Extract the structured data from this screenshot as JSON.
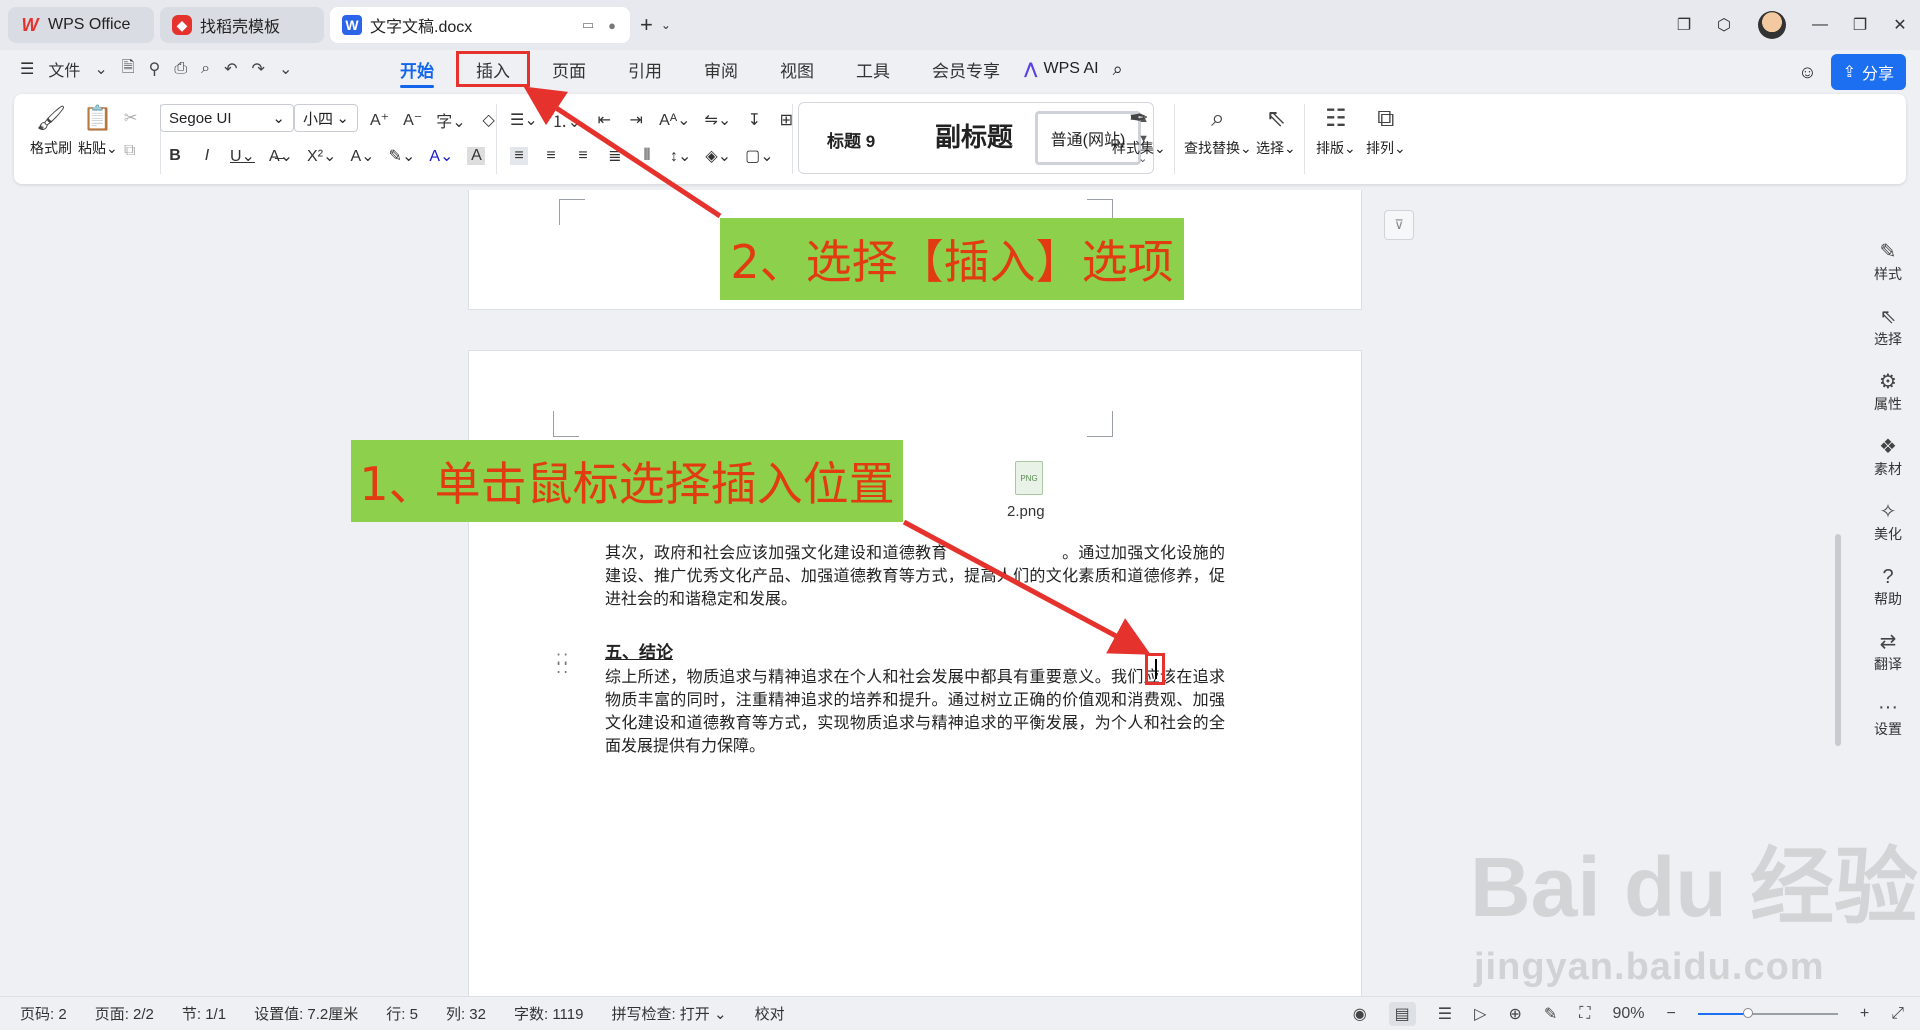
{
  "tabs": [
    {
      "label": "WPS Office",
      "icon": "wps-logo-icon"
    },
    {
      "label": "找稻壳模板",
      "icon": "docer-icon"
    },
    {
      "label": "文字文稿.docx",
      "icon": "word-doc-icon"
    }
  ],
  "menu": {
    "file_label": "文件",
    "tabs": [
      "开始",
      "插入",
      "页面",
      "引用",
      "审阅",
      "视图",
      "工具",
      "会员专享"
    ],
    "active_tab": "开始",
    "highlighted_tab": "插入",
    "ai_label": "WPS AI",
    "share_label": "分享"
  },
  "ribbon": {
    "format_painter": "格式刷",
    "paste": "粘贴",
    "font_name": "Segoe UI",
    "font_size": "小四",
    "styles": {
      "heading9": "标题 9",
      "subtitle": "副标题",
      "normal": "普通(网站)"
    },
    "style_set": "样式集",
    "find_replace": "查找替换",
    "select": "选择",
    "layout": "排版",
    "arrange": "排列"
  },
  "document": {
    "attachment_name": "2.png",
    "paragraph1": "其次，政府和社会应该加强文化建设和道德教育　　　　　　　。通过加强文化设施的建设、推广优秀文化产品、加强道德教育等方式，提高人们的文化素质和道德修养，促进社会的和谐稳定和发展。",
    "heading": "五、结论",
    "paragraph2": "综上所述，物质追求与精神追求在个人和社会发展中都具有重要意义。我们应该在追求物质丰富的同时，注重精神追求的培养和提升。通过树立正确的价值观和消费观、加强文化建设和道德教育等方式，实现物质追求与精神追求的平衡发展，为个人和社会的全面发展提供有力保障。"
  },
  "annotations": {
    "step1": "1、单击鼠标选择插入位置",
    "step2": "2、选择【插入】选项",
    "color_box": "#8dd04b",
    "color_text": "#e23b12"
  },
  "sidepanel": [
    "样式",
    "选择",
    "属性",
    "素材",
    "美化",
    "帮助",
    "翻译",
    "设置"
  ],
  "status": {
    "page_code": "页码: 2",
    "pages": "页面: 2/2",
    "section": "节: 1/1",
    "setting": "设置值: 7.2厘米",
    "row": "行: 5",
    "col": "列: 32",
    "words": "字数: 1119",
    "spell": "拼写检查: 打开",
    "proof": "校对",
    "zoom": "90%",
    "zoom_fraction": 0.36
  },
  "watermark": {
    "main": "Bai du 经验",
    "sub": "jingyan.baidu.com"
  }
}
